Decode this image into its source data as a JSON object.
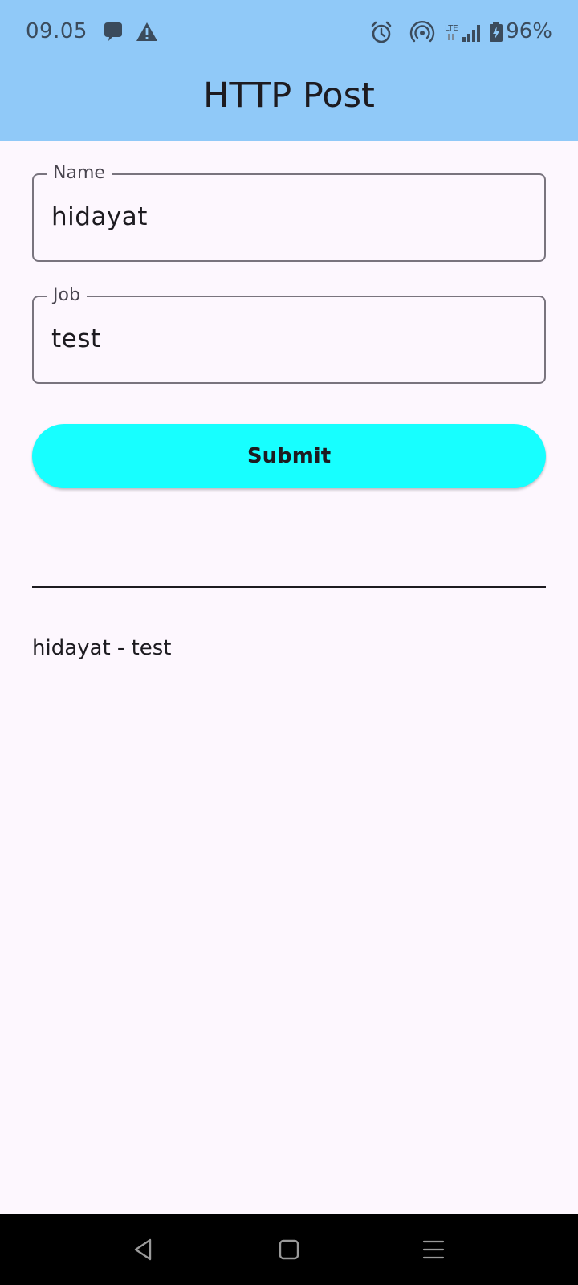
{
  "status_bar": {
    "time": "09.05",
    "battery_percent": "96%",
    "network_label": "LTE",
    "icons": [
      "chat-bubble-icon",
      "warning-icon",
      "alarm-icon",
      "hotspot-icon",
      "signal-icon",
      "battery-charging-icon"
    ]
  },
  "app_bar": {
    "title": "HTTP Post"
  },
  "form": {
    "name_label": "Name",
    "name_value": "hidayat",
    "job_label": "Job",
    "job_value": "test",
    "submit_label": "Submit"
  },
  "result": {
    "text": "hidayat - test"
  },
  "colors": {
    "app_bar_bg": "#90c9f8",
    "page_bg": "#fdf7fe",
    "button_bg": "#17ffff",
    "nav_bar_bg": "#000000"
  },
  "nav_bar": {
    "icons": [
      "back-icon",
      "home-icon",
      "recents-icon"
    ]
  }
}
